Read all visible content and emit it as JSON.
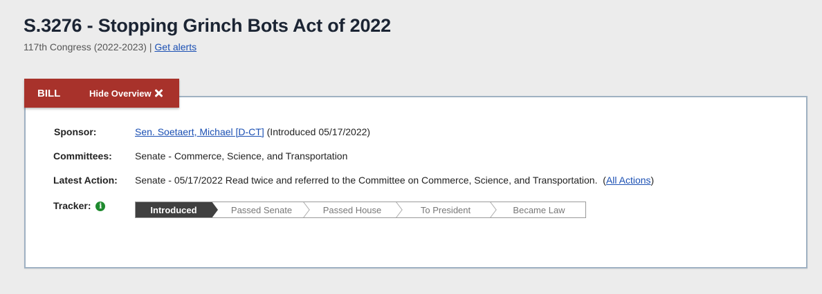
{
  "bill": {
    "title": "S.3276 - Stopping Grinch Bots Act of 2022",
    "congress": "117th Congress (2022-2023)",
    "separator": "|",
    "alerts_link": "Get alerts"
  },
  "tabs": {
    "bill_label": "BILL",
    "hide_label": "Hide Overview"
  },
  "overview": {
    "sponsor_label": "Sponsor:",
    "sponsor_name": "Sen. Soetaert, Michael [D-CT]",
    "sponsor_intro": "(Introduced 05/17/2022)",
    "committees_label": "Committees:",
    "committees_value": "Senate - Commerce, Science, and Transportation",
    "latest_action_label": "Latest Action:",
    "latest_action_value": "Senate - 05/17/2022 Read twice and referred to the Committee on Commerce, Science, and Transportation.",
    "all_actions_open": "(",
    "all_actions_link": "All Actions",
    "all_actions_close": ")",
    "tracker_label": "Tracker:",
    "tracker_steps": [
      "Introduced",
      "Passed Senate",
      "Passed House",
      "To President",
      "Became Law"
    ],
    "tracker_active_step": "Introduced"
  },
  "colors": {
    "tab_red": "#a8322b",
    "link_blue": "#1a4fb3",
    "tracker_active": "#404040",
    "info_green": "#1e8a2e"
  }
}
